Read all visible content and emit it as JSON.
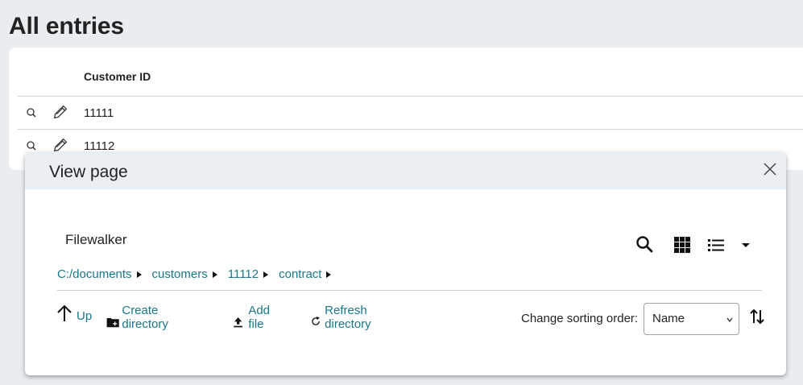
{
  "page": {
    "title": "All entries"
  },
  "table": {
    "column_header": "Customer ID",
    "rows": [
      {
        "customer_id": "11111"
      },
      {
        "customer_id": "11112"
      }
    ]
  },
  "dialog": {
    "title": "View page",
    "filewalker": {
      "title": "Filewalker",
      "breadcrumb": [
        "C:/documents",
        "customers",
        "11112",
        "contract"
      ],
      "actions": {
        "up": "Up",
        "create_directory": "Create directory",
        "add_file": "Add file",
        "refresh_directory": "Refresh directory"
      },
      "sorting": {
        "label": "Change sorting order:",
        "selected": "Name"
      }
    }
  },
  "colors": {
    "link": "#1a7788",
    "header_bg": "#e9eff2",
    "page_bg": "#e9edf0"
  }
}
